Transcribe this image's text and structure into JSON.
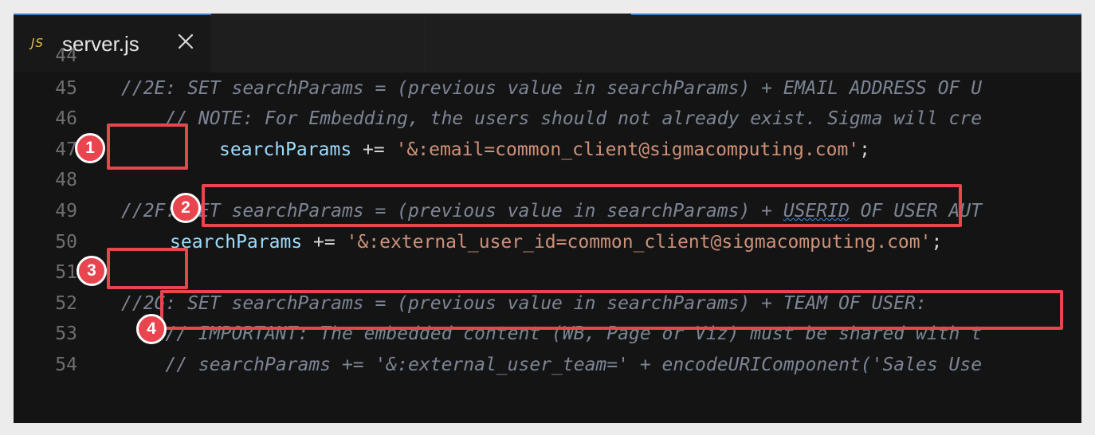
{
  "tab": {
    "file_type_label": "JS",
    "file_name": "server.js"
  },
  "colors": {
    "annotation": "#e8454f",
    "comment": "#7d8595",
    "variable": "#9cdcfe",
    "string": "#ce9178"
  },
  "lines": [
    {
      "number": "44",
      "segments": []
    },
    {
      "number": "45",
      "segments": [
        {
          "type": "comment",
          "text": "//2E: SET searchParams = (previous value in searchParams) + EMAIL ADDRESS OF U"
        }
      ]
    },
    {
      "number": "46",
      "segments": [
        {
          "type": "comment",
          "text": "    // NOTE: For Embedding, the users should not already exist. Sigma will cre"
        }
      ]
    },
    {
      "number": "47",
      "segments": [
        {
          "type": "variable",
          "text": "searchParams"
        },
        {
          "type": "operator",
          "text": " += "
        },
        {
          "type": "string",
          "text": "'&:email=common_client@sigmacomputing.com'"
        },
        {
          "type": "operator",
          "text": ";"
        }
      ]
    },
    {
      "number": "48",
      "segments": []
    },
    {
      "number": "49",
      "segments": [
        {
          "type": "comment",
          "text": "//2F: SET searchParams = (previous value in searchParams) + "
        },
        {
          "type": "comment-squiggle",
          "text": "USERID"
        },
        {
          "type": "comment",
          "text": " OF USER AUT"
        }
      ]
    },
    {
      "number": "50",
      "segments": [
        {
          "type": "variable",
          "text": "searchParams"
        },
        {
          "type": "operator",
          "text": " += "
        },
        {
          "type": "string",
          "text": "'&:external_user_id=common_client@sigmacomputing.com'"
        },
        {
          "type": "operator",
          "text": ";"
        }
      ]
    },
    {
      "number": "51",
      "segments": []
    },
    {
      "number": "52",
      "segments": [
        {
          "type": "comment",
          "text": "//2G: SET searchParams = (previous value in searchParams) + TEAM OF USER:"
        }
      ]
    },
    {
      "number": "53",
      "segments": [
        {
          "type": "comment",
          "text": "    // IMPORTANT: The embedded content (WB, Page or Viz) must be shared with t"
        }
      ]
    },
    {
      "number": "54",
      "segments": [
        {
          "type": "comment",
          "text": "    // searchParams += '&:external_user_team=' + encodeURIComponent('Sales Use"
        }
      ]
    }
  ],
  "annotations": [
    {
      "label": "1"
    },
    {
      "label": "2"
    },
    {
      "label": "3"
    },
    {
      "label": "4"
    }
  ]
}
